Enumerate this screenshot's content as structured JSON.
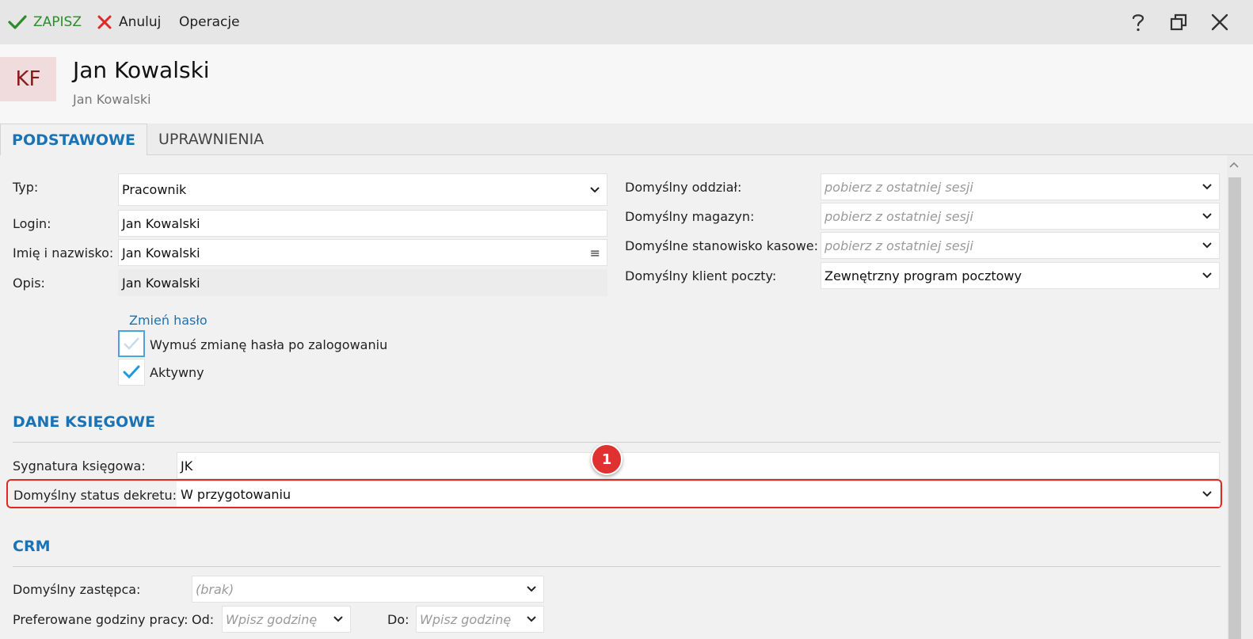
{
  "toolbar": {
    "save_label": "ZAPISZ",
    "cancel_label": "Anuluj",
    "operations_label": "Operacje"
  },
  "header": {
    "avatar_initials": "KF",
    "title": "Jan Kowalski",
    "subtitle": "Jan Kowalski"
  },
  "tabs": [
    {
      "label": "PODSTAWOWE",
      "active": true
    },
    {
      "label": "UPRAWNIENIA",
      "active": false
    }
  ],
  "left_form": {
    "typ": {
      "label": "Typ:",
      "value": "Pracownik"
    },
    "login": {
      "label": "Login:",
      "value": "Jan Kowalski"
    },
    "name": {
      "label": "Imię i nazwisko:",
      "value": "Jan Kowalski"
    },
    "opis": {
      "label": "Opis:",
      "value": "Jan Kowalski"
    },
    "change_password": "Zmień hasło",
    "force_change": {
      "label": "Wymuś zmianę hasła po zalogowaniu",
      "checked": false
    },
    "active": {
      "label": "Aktywny",
      "checked": true
    }
  },
  "right_form": {
    "branch": {
      "label": "Domyślny oddział:",
      "placeholder": "pobierz z ostatniej sesji"
    },
    "warehouse": {
      "label": "Domyślny magazyn:",
      "placeholder": "pobierz z ostatniej sesji"
    },
    "cash_station": {
      "label": "Domyślne stanowisko kasowe:",
      "placeholder": "pobierz z ostatniej sesji"
    },
    "mail_client": {
      "label": "Domyślny klient poczty:",
      "value": "Zewnętrzny program pocztowy"
    }
  },
  "accounting": {
    "section_title": "DANE KSIĘGOWE",
    "signature": {
      "label": "Sygnatura księgowa:",
      "value": "JK"
    },
    "decree_status": {
      "label": "Domyślny status dekretu:",
      "value": "W przygotowaniu"
    },
    "badge": "1"
  },
  "crm": {
    "section_title": "CRM",
    "deputy": {
      "label": "Domyślny zastępca:",
      "placeholder": "(brak)"
    },
    "hours": {
      "label": "Preferowane godziny pracy:",
      "from_label": "Od:",
      "from_placeholder": "Wpisz godzinę",
      "to_label": "Do:",
      "to_placeholder": "Wpisz godzinę"
    }
  },
  "colors": {
    "accent": "#1a73b5",
    "save": "#2e8b2e",
    "cancel": "#e02828",
    "highlight": "#e02828"
  },
  "icons": [
    "check-icon",
    "x-icon",
    "help-icon",
    "restore-icon",
    "close-icon",
    "chevron-down-icon",
    "menu-icon"
  ]
}
